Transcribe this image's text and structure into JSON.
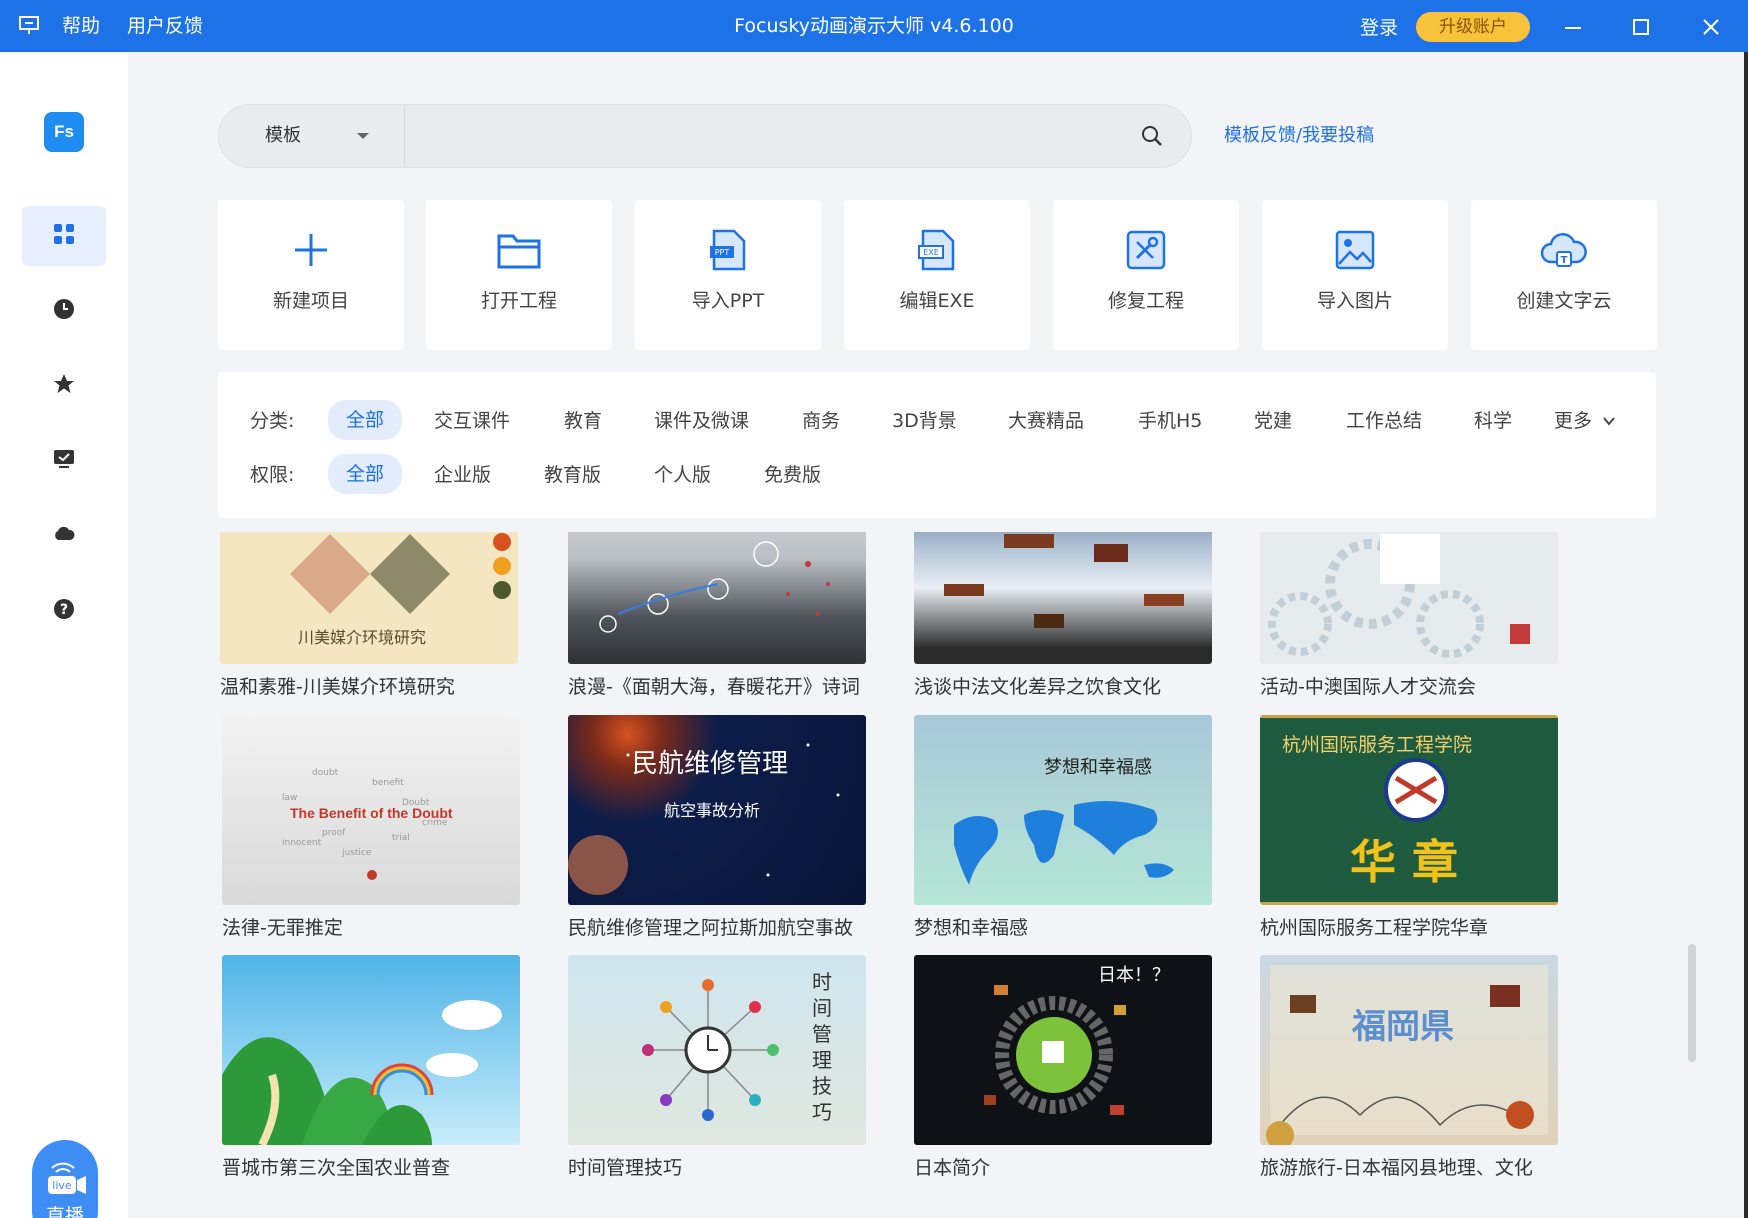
{
  "titlebar": {
    "help": "帮助",
    "feedback": "用户反馈",
    "title": "Focusky动画演示大师 v4.6.100",
    "login": "登录",
    "upgrade": "升级账户"
  },
  "sidebar": {
    "logo": "Fs",
    "items": [
      "apps-grid-icon",
      "clock-icon",
      "star-icon",
      "monitor-icon",
      "cloud-icon",
      "help-icon"
    ],
    "live_label": "直播",
    "live_badge": "live"
  },
  "search": {
    "type_label": "模板",
    "value": "",
    "placeholder": ""
  },
  "feedback_link": "模板反馈/我要投稿",
  "actions": [
    {
      "label": "新建项目",
      "icon": "plus-icon"
    },
    {
      "label": "打开工程",
      "icon": "folder-icon"
    },
    {
      "label": "导入PPT",
      "icon": "ppt-file-icon"
    },
    {
      "label": "编辑EXE",
      "icon": "exe-file-icon"
    },
    {
      "label": "修复工程",
      "icon": "repair-tools-icon"
    },
    {
      "label": "导入图片",
      "icon": "image-icon"
    },
    {
      "label": "创建文字云",
      "icon": "word-cloud-icon"
    }
  ],
  "filters": {
    "category_label": "分类:",
    "categories": [
      "全部",
      "交互课件",
      "教育",
      "课件及微课",
      "商务",
      "3D背景",
      "大赛精品",
      "手机H5",
      "党建",
      "工作总结",
      "科学",
      "更多"
    ],
    "permission_label": "权限:",
    "permissions": [
      "全部",
      "企业版",
      "教育版",
      "个人版",
      "免费版"
    ]
  },
  "templates": [
    {
      "title": "温和素雅-川美媒介环境研究",
      "thumb_text": "川美媒介环境研究"
    },
    {
      "title": "浪漫-《面朝大海，春暖花开》诗词",
      "thumb_text": ""
    },
    {
      "title": "浅谈中法文化差异之饮食文化",
      "thumb_text": ""
    },
    {
      "title": "活动-中澳国际人才交流会",
      "thumb_text": ""
    },
    {
      "title": "法律-无罪推定",
      "thumb_text": "The Benefit of the Doubt"
    },
    {
      "title": "民航维修管理之阿拉斯加航空事故",
      "thumb_text": "民航维修管理",
      "thumb_sub": "航空事故分析"
    },
    {
      "title": "梦想和幸福感",
      "thumb_text": "梦想和幸福感"
    },
    {
      "title": "杭州国际服务工程学院华章",
      "thumb_text": "杭州国际服务工程学院",
      "thumb_sub": "华 章"
    },
    {
      "title": "晋城市第三次全国农业普查",
      "thumb_text": ""
    },
    {
      "title": "时间管理技巧",
      "thumb_text": "时间管理技巧"
    },
    {
      "title": "日本简介",
      "thumb_text": "日本！？"
    },
    {
      "title": "旅游旅行-日本福冈县地理、文化",
      "thumb_text": "福岡県"
    }
  ],
  "colors": {
    "primary": "#1e72e8",
    "upgrade": "#f8c23a",
    "accent_text": "#1e6fe0"
  }
}
